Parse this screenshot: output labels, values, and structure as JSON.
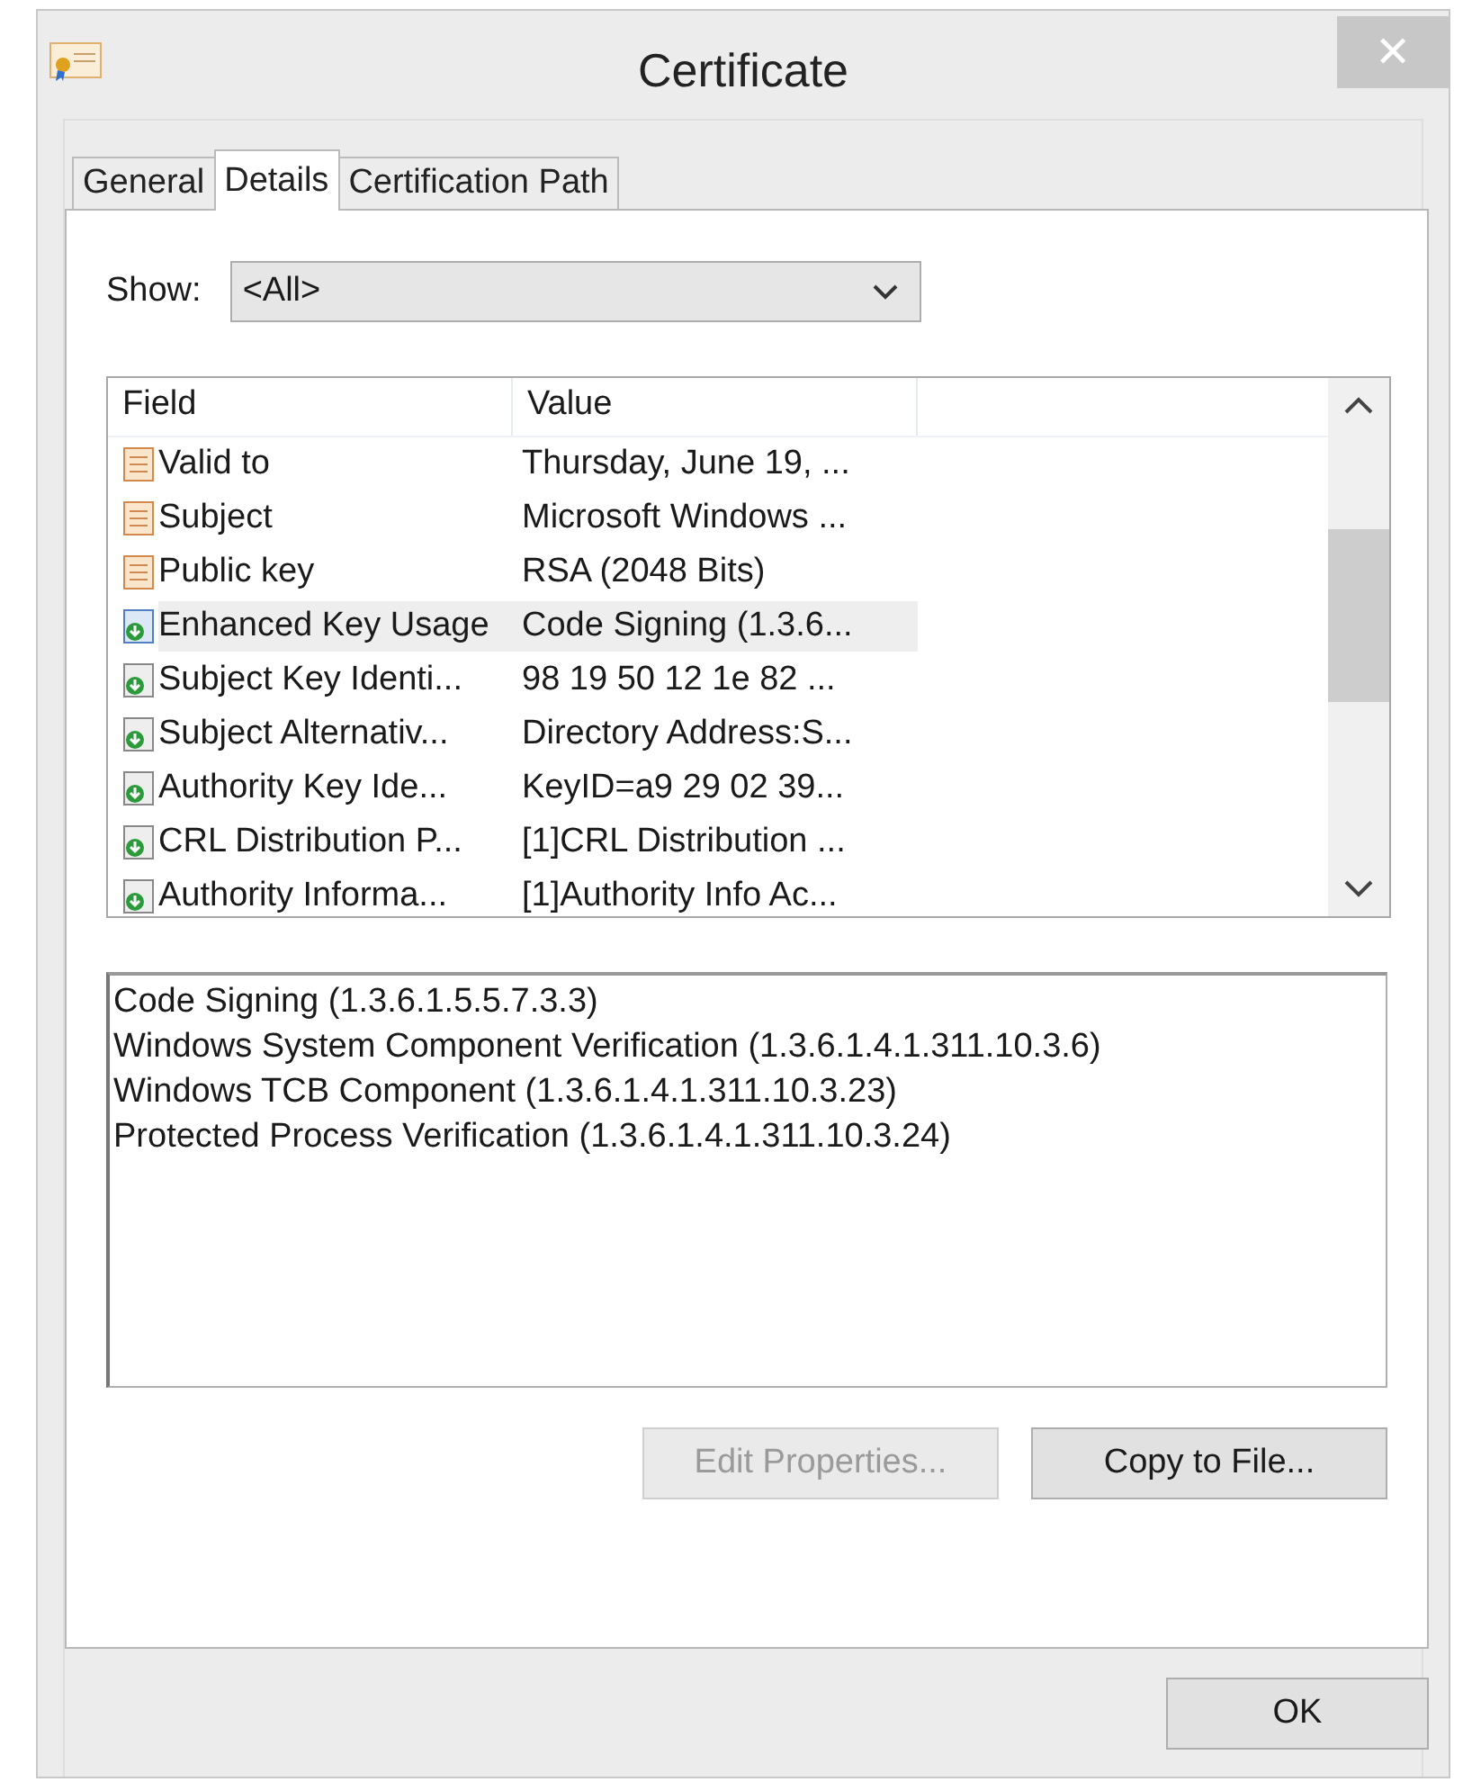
{
  "window": {
    "title": "Certificate",
    "close": "✕"
  },
  "tabs": [
    {
      "label": "General",
      "selected": false
    },
    {
      "label": "Details",
      "selected": true
    },
    {
      "label": "Certification Path",
      "selected": false
    }
  ],
  "show": {
    "label": "Show:",
    "value": "<All>"
  },
  "table": {
    "columns": [
      "Field",
      "Value"
    ],
    "rows": [
      {
        "kind": "property",
        "field": "Valid to",
        "value": "Thursday, June 19, ...",
        "selected": false
      },
      {
        "kind": "property",
        "field": "Subject",
        "value": "Microsoft Windows ...",
        "selected": false
      },
      {
        "kind": "property",
        "field": "Public key",
        "value": "RSA (2048 Bits)",
        "selected": false
      },
      {
        "kind": "extension",
        "field": "Enhanced Key Usage",
        "value": "Code Signing (1.3.6...",
        "selected": true
      },
      {
        "kind": "extension",
        "field": "Subject Key Identi...",
        "value": "98 19 50 12 1e 82 ...",
        "selected": false
      },
      {
        "kind": "extension",
        "field": "Subject Alternativ...",
        "value": "Directory Address:S...",
        "selected": false
      },
      {
        "kind": "extension",
        "field": "Authority Key Ide...",
        "value": "KeyID=a9 29 02 39...",
        "selected": false
      },
      {
        "kind": "extension",
        "field": "CRL Distribution P...",
        "value": "[1]CRL Distribution ...",
        "selected": false
      },
      {
        "kind": "extension",
        "field": "Authority Informa...",
        "value": "[1]Authority Info Ac...",
        "selected": false
      }
    ]
  },
  "detail_lines": [
    "Code Signing (1.3.6.1.5.5.7.3.3)",
    "Windows System Component Verification (1.3.6.1.4.1.311.10.3.6)",
    "Windows TCB Component (1.3.6.1.4.1.311.10.3.23)",
    "Protected Process Verification (1.3.6.1.4.1.311.10.3.24)"
  ],
  "buttons": [
    {
      "label": "Edit Properties...",
      "disabled": true
    },
    {
      "label": "Copy to File...",
      "disabled": false
    }
  ],
  "ok_button": "OK"
}
